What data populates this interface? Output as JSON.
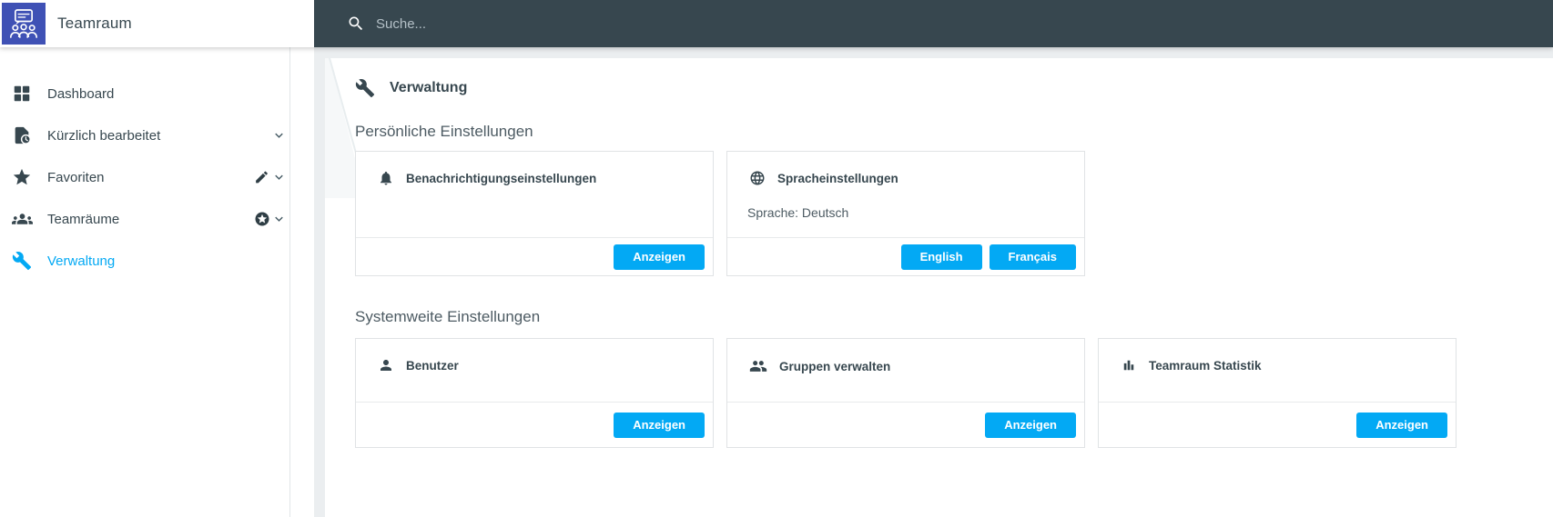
{
  "brand": {
    "title": "Teamraum"
  },
  "topbar": {
    "search_placeholder": "Suche..."
  },
  "sidebar": {
    "items": [
      {
        "label": "Dashboard"
      },
      {
        "label": "Kürzlich bearbeitet"
      },
      {
        "label": "Favoriten"
      },
      {
        "label": "Teamräume"
      },
      {
        "label": "Verwaltung"
      }
    ]
  },
  "page": {
    "title": "Verwaltung",
    "sections": [
      {
        "heading": "Persönliche Einstellungen",
        "cards": [
          {
            "title": "Benachrichtigungseinstellungen",
            "buttons": [
              {
                "label": "Anzeigen"
              }
            ]
          },
          {
            "title": "Spracheinstellungen",
            "body": "Sprache: Deutsch",
            "buttons": [
              {
                "label": "English"
              },
              {
                "label": "Français"
              }
            ]
          }
        ]
      },
      {
        "heading": "Systemweite Einstellungen",
        "cards": [
          {
            "title": "Benutzer",
            "buttons": [
              {
                "label": "Anzeigen"
              }
            ]
          },
          {
            "title": "Gruppen verwalten",
            "buttons": [
              {
                "label": "Anzeigen"
              }
            ]
          },
          {
            "title": "Teamraum Statistik",
            "buttons": [
              {
                "label": "Anzeigen"
              }
            ]
          }
        ]
      }
    ]
  },
  "colors": {
    "accent": "#03a9f4",
    "brand_indigo": "#3f51b5",
    "topbar_slate": "#37474f",
    "page_bg": "#ebeef0"
  }
}
